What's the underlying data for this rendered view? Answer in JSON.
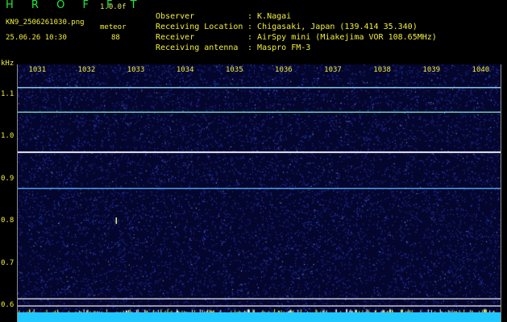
{
  "header": {
    "app_title": "H R O F F T",
    "version": "1.0.0f",
    "filename": "KN9_2506261030.png",
    "mode": "meteor",
    "timestamp": "25.06.26 10:30",
    "count": "88"
  },
  "info": [
    {
      "label": "Observer",
      "value": "K.Nagai"
    },
    {
      "label": "Receiving Location",
      "value": "Chigasaki, Japan (139.414 35.340)"
    },
    {
      "label": "Receiver",
      "value": "AirSpy mini (Miakejima VOR 108.65MHz)"
    },
    {
      "label": "Receiving antenna",
      "value": "Maspro FM-3"
    }
  ],
  "axes": {
    "y_unit": "kHz",
    "x_ticks": [
      "1031",
      "1032",
      "1033",
      "1034",
      "1035",
      "1036",
      "1037",
      "1038",
      "1039",
      "1040"
    ],
    "y_ticks": [
      "1.1",
      "1.0",
      "0.9",
      "0.8",
      "0.7",
      "0.6"
    ]
  },
  "spectrogram": {
    "x_range_min": [
      1030.6,
      1040.4
    ],
    "y_range_khz": [
      0.56,
      1.17
    ],
    "background_color": "#05062e",
    "noise_color": "#2c44d6",
    "signal_lines_khz": [
      1.115,
      1.057,
      0.962,
      0.876,
      0.615,
      0.598
    ],
    "signal_colors": [
      "#9fe7ff",
      "#7fe7c9",
      "#f0f3ff",
      "#5fb3ff",
      "#ffffff",
      "#ffffff"
    ],
    "meteor_trace_min": 1032.6,
    "meteor_trace_khz": 0.8
  }
}
